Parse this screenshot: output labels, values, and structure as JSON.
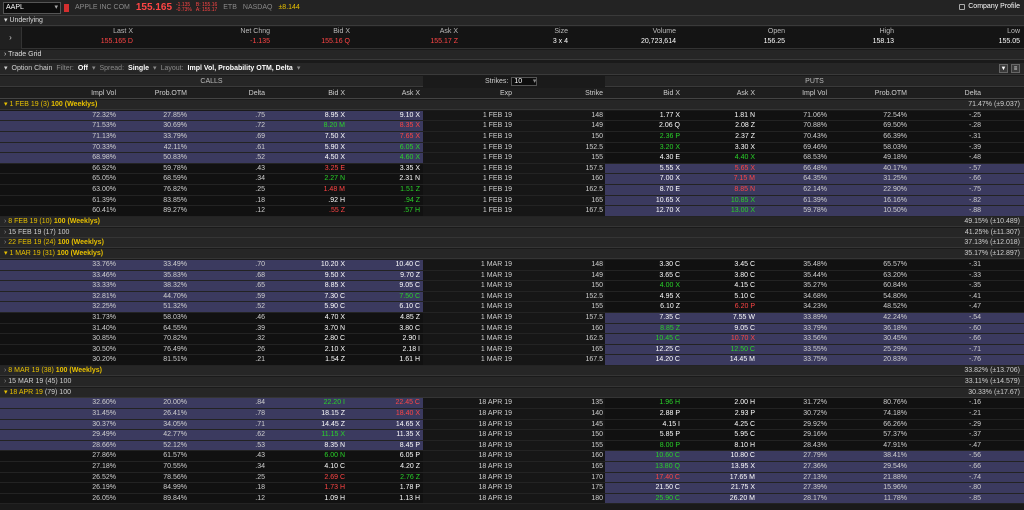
{
  "topbar": {
    "symbol": "AAPL",
    "company": "APPLE INC COM",
    "last": "155.165",
    "chg1": "-1.135",
    "chg2": "-0.73%",
    "bid_small": "B: 155.16",
    "ask_small": "A: 155.17",
    "exch1": "ETB",
    "exch2": "NASDAQ",
    "impl": "±8.144",
    "company_profile": "Company Profile"
  },
  "underlying": {
    "title": "Underlying",
    "cols": [
      {
        "label": "Last X",
        "value": "155.165 D",
        "color": "red"
      },
      {
        "label": "Net Chng",
        "value": "-1.135",
        "color": "red"
      },
      {
        "label": "Bid X",
        "value": "155.16 Q",
        "color": "red"
      },
      {
        "label": "Ask X",
        "value": "155.17 Z",
        "color": "red"
      },
      {
        "label": "Size",
        "value": "3 x 4",
        "color": "wht"
      },
      {
        "label": "Volume",
        "value": "20,723,614",
        "color": "wht"
      },
      {
        "label": "Open",
        "value": "156.25",
        "color": "wht"
      },
      {
        "label": "High",
        "value": "158.13",
        "color": "wht"
      },
      {
        "label": "Low",
        "value": "155.05",
        "color": "wht"
      }
    ]
  },
  "trade_grid": "Trade Grid",
  "option_chain": {
    "title": "Option Chain",
    "filter_label": "Filter:",
    "filter": "Off",
    "spread_label": "Spread:",
    "spread": "Single",
    "layout_label": "Layout:",
    "layout": "Impl Vol, Probability OTM, Delta"
  },
  "bands": {
    "calls": "CALLS",
    "puts": "PUTS",
    "strikes_label": "Strikes:",
    "strikes": "10"
  },
  "columns": {
    "c_iv": "Impl Vol",
    "c_prob": "Prob.OTM",
    "c_delta": "Delta",
    "c_bid": "Bid X",
    "c_ask": "Ask X",
    "exp": "Exp",
    "strike": "Strike",
    "p_bid": "Bid X",
    "p_ask": "Ask X",
    "p_iv": "Impl Vol",
    "p_prob": "Prob.OTM",
    "p_delta": "Delta"
  },
  "groups": [
    {
      "label": "1 FEB 19",
      "days": "(3)",
      "mult": "100 (Weeklys)",
      "right": "71.47% (±9.037)",
      "expanded": true,
      "rows": [
        [
          "72.32%",
          "27.85%",
          ".75",
          "8.95 X",
          "9.10 X",
          "1 FEB 19",
          "148",
          "1.77 X",
          "1.81 N",
          "71.06%",
          "72.54%",
          "-.25",
          "itm",
          "otm"
        ],
        [
          "71.53%",
          "30.69%",
          ".72",
          "8.20 M",
          "8.35 X",
          "1 FEB 19",
          "149",
          "2.06 Q",
          "2.08 Z",
          "70.88%",
          "69.50%",
          "-.28",
          "itm",
          "otm"
        ],
        [
          "71.13%",
          "33.79%",
          ".69",
          "7.50 X",
          "7.65 X",
          "1 FEB 19",
          "150",
          "2.36 P",
          "2.37 Z",
          "70.43%",
          "66.39%",
          "-.31",
          "itm",
          "otm"
        ],
        [
          "70.33%",
          "42.11%",
          ".61",
          "5.90 X",
          "6.05 X",
          "1 FEB 19",
          "152.5",
          "3.20 X",
          "3.30 X",
          "69.46%",
          "58.03%",
          "-.39",
          "itm",
          "otm"
        ],
        [
          "68.98%",
          "50.83%",
          ".52",
          "4.50 X",
          "4.60 X",
          "1 FEB 19",
          "155",
          "4.30 E",
          "4.40 X",
          "68.53%",
          "49.18%",
          "-.48",
          "itm",
          "otm"
        ],
        [
          "66.92%",
          "59.78%",
          ".43",
          "3.25 E",
          "3.35 X",
          "1 FEB 19",
          "157.5",
          "5.55 X",
          "5.65 X",
          "66.48%",
          "40.17%",
          "-.57",
          "otm",
          "itm"
        ],
        [
          "65.05%",
          "68.59%",
          ".34",
          "2.27 N",
          "2.31 N",
          "1 FEB 19",
          "160",
          "7.00 X",
          "7.15 M",
          "64.35%",
          "31.25%",
          "-.66",
          "otm",
          "itm"
        ],
        [
          "63.00%",
          "76.82%",
          ".25",
          "1.48 M",
          "1.51 Z",
          "1 FEB 19",
          "162.5",
          "8.70 E",
          "8.85 N",
          "62.14%",
          "22.90%",
          "-.75",
          "otm",
          "itm"
        ],
        [
          "61.39%",
          "83.85%",
          ".18",
          ".92 H",
          ".94 Z",
          "1 FEB 19",
          "165",
          "10.65 X",
          "10.85 X",
          "61.39%",
          "16.16%",
          "-.82",
          "otm",
          "itm"
        ],
        [
          "60.41%",
          "89.27%",
          ".12",
          ".55 Z",
          ".57 H",
          "1 FEB 19",
          "167.5",
          "12.70 X",
          "13.00 X",
          "59.78%",
          "10.50%",
          "-.88",
          "otm",
          "itm"
        ]
      ]
    },
    {
      "label": "8 FEB 19",
      "days": "(10)",
      "mult": "100 (Weeklys)",
      "right": "49.15% (±10.489)",
      "expanded": false,
      "rows": []
    },
    {
      "label": "15 FEB 19",
      "days": "(17)",
      "mult": "100",
      "right": "41.25% (±11.307)",
      "expanded": false,
      "rows": []
    },
    {
      "label": "22 FEB 19",
      "days": "(24)",
      "mult": "100 (Weeklys)",
      "right": "37.13% (±12.018)",
      "expanded": false,
      "rows": []
    },
    {
      "label": "1 MAR 19",
      "days": "(31)",
      "mult": "100 (Weeklys)",
      "right": "35.17% (±12.897)",
      "expanded": true,
      "rows": [
        [
          "33.76%",
          "33.49%",
          ".70",
          "10.20 X",
          "10.40 C",
          "1 MAR 19",
          "148",
          "3.30 C",
          "3.45 C",
          "35.48%",
          "65.57%",
          "-.31",
          "itm",
          "otm"
        ],
        [
          "33.46%",
          "35.83%",
          ".68",
          "9.50 X",
          "9.70 Z",
          "1 MAR 19",
          "149",
          "3.65 C",
          "3.80 C",
          "35.44%",
          "63.20%",
          "-.33",
          "itm",
          "otm"
        ],
        [
          "33.33%",
          "38.32%",
          ".65",
          "8.85 X",
          "9.05 C",
          "1 MAR 19",
          "150",
          "4.00 X",
          "4.15 C",
          "35.27%",
          "60.84%",
          "-.35",
          "itm",
          "otm"
        ],
        [
          "32.81%",
          "44.70%",
          ".59",
          "7.30 C",
          "7.50 C",
          "1 MAR 19",
          "152.5",
          "4.95 X",
          "5.10 C",
          "34.68%",
          "54.80%",
          "-.41",
          "itm",
          "otm"
        ],
        [
          "32.25%",
          "51.32%",
          ".52",
          "5.90 C",
          "6.10 C",
          "1 MAR 19",
          "155",
          "6.10 Z",
          "6.20 P",
          "34.23%",
          "48.52%",
          "-.47",
          "itm",
          "otm"
        ],
        [
          "31.73%",
          "58.03%",
          ".46",
          "4.70 X",
          "4.85 Z",
          "1 MAR 19",
          "157.5",
          "7.35 C",
          "7.55 W",
          "33.89%",
          "42.24%",
          "-.54",
          "otm",
          "itm"
        ],
        [
          "31.40%",
          "64.55%",
          ".39",
          "3.70 N",
          "3.80 C",
          "1 MAR 19",
          "160",
          "8.85 Z",
          "9.05 C",
          "33.79%",
          "36.18%",
          "-.60",
          "otm",
          "itm"
        ],
        [
          "30.85%",
          "70.82%",
          ".32",
          "2.80 C",
          "2.90 I",
          "1 MAR 19",
          "162.5",
          "10.45 C",
          "10.70 X",
          "33.56%",
          "30.45%",
          "-.66",
          "otm",
          "itm"
        ],
        [
          "30.50%",
          "76.49%",
          ".26",
          "2.10 X",
          "2.18 I",
          "1 MAR 19",
          "165",
          "12.25 C",
          "12.50 C",
          "33.55%",
          "25.29%",
          "-.71",
          "otm",
          "itm"
        ],
        [
          "30.20%",
          "81.51%",
          ".21",
          "1.54 Z",
          "1.61 H",
          "1 MAR 19",
          "167.5",
          "14.20 C",
          "14.45 M",
          "33.75%",
          "20.83%",
          "-.76",
          "otm",
          "itm"
        ]
      ]
    },
    {
      "label": "8 MAR 19",
      "days": "(38)",
      "mult": "100 (Weeklys)",
      "right": "33.82% (±13.706)",
      "expanded": false,
      "rows": []
    },
    {
      "label": "15 MAR 19",
      "days": "(45)",
      "mult": "100",
      "right": "33.11% (±14.579)",
      "expanded": false,
      "rows": []
    },
    {
      "label": "18 APR 19",
      "days": "(79)",
      "mult": "100",
      "right": "30.33% (±17.67)",
      "expanded": true,
      "rows": [
        [
          "32.60%",
          "20.00%",
          ".84",
          "22.20 I",
          "22.45 C",
          "18 APR 19",
          "135",
          "1.96 H",
          "2.00 H",
          "31.72%",
          "80.76%",
          "-.16",
          "itm",
          "otm"
        ],
        [
          "31.45%",
          "26.41%",
          ".78",
          "18.15 Z",
          "18.40 X",
          "18 APR 19",
          "140",
          "2.88 P",
          "2.93 P",
          "30.72%",
          "74.18%",
          "-.21",
          "itm",
          "otm"
        ],
        [
          "30.37%",
          "34.05%",
          ".71",
          "14.45 Z",
          "14.65 X",
          "18 APR 19",
          "145",
          "4.15 I",
          "4.25 C",
          "29.92%",
          "66.26%",
          "-.29",
          "itm",
          "otm"
        ],
        [
          "29.49%",
          "42.77%",
          ".62",
          "11.15 X",
          "11.35 X",
          "18 APR 19",
          "150",
          "5.85 P",
          "5.95 C",
          "29.16%",
          "57.37%",
          "-.37",
          "itm",
          "otm"
        ],
        [
          "28.66%",
          "52.12%",
          ".53",
          "8.35 N",
          "8.45 P",
          "18 APR 19",
          "155",
          "8.00 P",
          "8.10 H",
          "28.43%",
          "47.91%",
          "-.47",
          "itm",
          "otm"
        ],
        [
          "27.86%",
          "61.57%",
          ".43",
          "6.00 N",
          "6.05 P",
          "18 APR 19",
          "160",
          "10.60 C",
          "10.80 C",
          "27.79%",
          "38.41%",
          "-.56",
          "otm",
          "itm"
        ],
        [
          "27.18%",
          "70.55%",
          ".34",
          "4.10 C",
          "4.20 Z",
          "18 APR 19",
          "165",
          "13.80 Q",
          "13.95 X",
          "27.36%",
          "29.54%",
          "-.66",
          "otm",
          "itm"
        ],
        [
          "26.52%",
          "78.56%",
          ".25",
          "2.69 C",
          "2.76 Z",
          "18 APR 19",
          "170",
          "17.40 C",
          "17.65 M",
          "27.13%",
          "21.88%",
          "-.74",
          "otm",
          "itm"
        ],
        [
          "26.19%",
          "84.99%",
          ".18",
          "1.73 H",
          "1.78 P",
          "18 APR 19",
          "175",
          "21.50 C",
          "21.75 X",
          "27.39%",
          "15.96%",
          "-.80",
          "otm",
          "itm"
        ],
        [
          "26.05%",
          "89.84%",
          ".12",
          "1.09 H",
          "1.13 H",
          "18 APR 19",
          "180",
          "25.90 C",
          "26.20 M",
          "28.17%",
          "11.78%",
          "-.85",
          "otm",
          "itm"
        ]
      ]
    }
  ],
  "tick_colors": {
    "1 FEB 19": [
      [
        "wht",
        "wht",
        "wht",
        "wht"
      ],
      [
        "grn",
        "red",
        "wht",
        "wht"
      ],
      [
        "wht",
        "red",
        "grn",
        "wht"
      ],
      [
        "wht",
        "grn",
        "grn",
        "wht"
      ],
      [
        "wht",
        "grn",
        "wht",
        "grn"
      ],
      [
        "red",
        "wht",
        "wht",
        "red"
      ],
      [
        "grn",
        "wht",
        "wht",
        "red"
      ],
      [
        "red",
        "grn",
        "wht",
        "red"
      ],
      [
        "wht",
        "grn",
        "wht",
        "grn"
      ],
      [
        "red",
        "grn",
        "wht",
        "grn"
      ]
    ],
    "1 MAR 19": [
      [
        "wht",
        "wht",
        "wht",
        "wht"
      ],
      [
        "wht",
        "wht",
        "wht",
        "wht"
      ],
      [
        "wht",
        "wht",
        "grn",
        "wht"
      ],
      [
        "wht",
        "grn",
        "wht",
        "wht"
      ],
      [
        "wht",
        "wht",
        "wht",
        "red"
      ],
      [
        "wht",
        "wht",
        "wht",
        "wht"
      ],
      [
        "wht",
        "wht",
        "grn",
        "wht"
      ],
      [
        "wht",
        "wht",
        "grn",
        "red"
      ],
      [
        "wht",
        "wht",
        "wht",
        "grn"
      ],
      [
        "wht",
        "wht",
        "wht",
        "wht"
      ]
    ],
    "18 APR 19": [
      [
        "grn",
        "red",
        "grn",
        "wht"
      ],
      [
        "wht",
        "red",
        "wht",
        "wht"
      ],
      [
        "wht",
        "wht",
        "wht",
        "wht"
      ],
      [
        "grn",
        "wht",
        "wht",
        "wht"
      ],
      [
        "wht",
        "wht",
        "grn",
        "wht"
      ],
      [
        "grn",
        "wht",
        "grn",
        "wht"
      ],
      [
        "wht",
        "wht",
        "grn",
        "wht"
      ],
      [
        "red",
        "grn",
        "red",
        "wht"
      ],
      [
        "red",
        "wht",
        "wht",
        "wht"
      ],
      [
        "wht",
        "wht",
        "grn",
        "wht"
      ]
    ]
  }
}
